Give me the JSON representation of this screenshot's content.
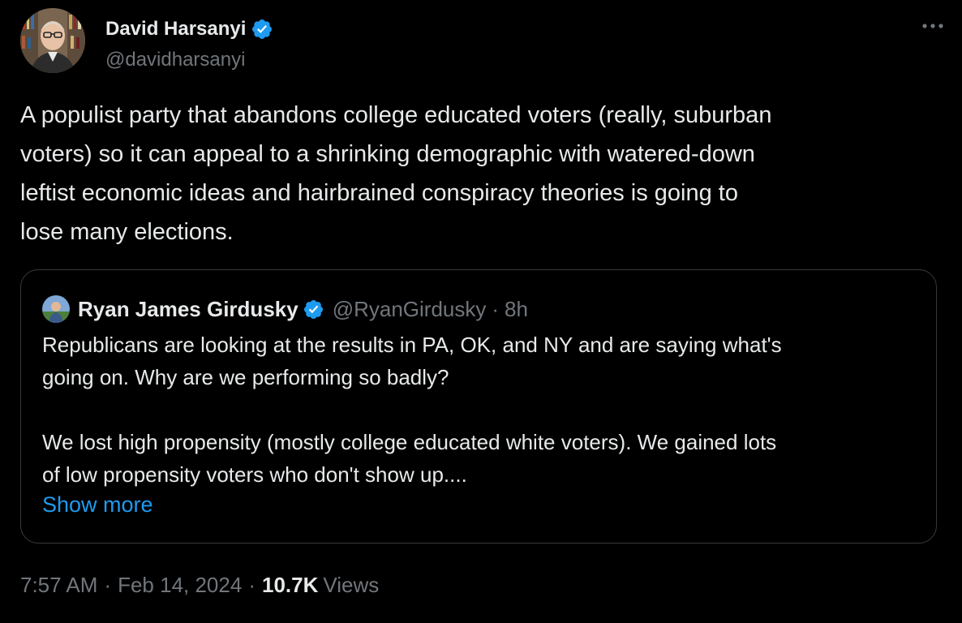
{
  "author": {
    "name": "David Harsanyi",
    "handle": "@davidharsanyi",
    "verified": true
  },
  "tweet": {
    "text": "A populist party that abandons college educated voters (really, suburban\nvoters) so it can appeal to a shrinking demographic with watered-down\nleftist economic ideas and hairbrained conspiracy theories is going to\nlose many elections."
  },
  "quoted": {
    "name": "Ryan James Girdusky",
    "handle": "@RyanGirdusky",
    "separator": "·",
    "time": "8h",
    "text": "Republicans are looking at the results in PA, OK, and NY and are saying what's\ngoing on. Why are we performing so badly?\n\nWe lost high propensity (mostly college educated white voters). We gained lots\nof low propensity voters who don't show up....",
    "show_more": "Show more"
  },
  "meta": {
    "time": "7:57 AM",
    "sep1": "·",
    "date": "Feb 14, 2024",
    "sep2": "·",
    "views_count": "10.7K",
    "views_label": "Views"
  },
  "icons": {
    "verified": "verified-badge-icon",
    "more": "more-horizontal-icon"
  },
  "colors": {
    "background": "#000000",
    "text": "#e7e9ea",
    "secondary": "#71767b",
    "accent": "#1d9bf0",
    "border": "#38393b"
  }
}
